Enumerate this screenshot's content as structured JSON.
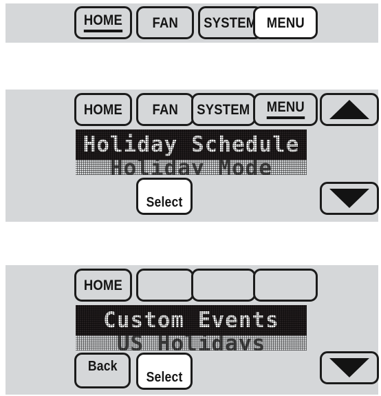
{
  "colors": {
    "panel_bg": "#d5d7d9",
    "key_bg": "#d5d7d9",
    "key_active_bg": "#ffffff",
    "key_border": "#1b1b1b",
    "lcd_bar_bg": "#241f20",
    "lcd_text_on": "#ffffff",
    "lcd_text_dim": "#4c4c4c",
    "page_bg": "#ffffff"
  },
  "panels": [
    {
      "id": "panel-1",
      "menu_keys": [
        {
          "label": "HOME",
          "state": "underlined"
        },
        {
          "label": "FAN",
          "state": "normal"
        },
        {
          "label": "SYSTEM",
          "state": "normal"
        },
        {
          "label": "MENU",
          "state": "highlighted"
        }
      ]
    },
    {
      "id": "panel-2",
      "menu_keys": [
        {
          "label": "HOME",
          "state": "normal"
        },
        {
          "label": "FAN",
          "state": "normal"
        },
        {
          "label": "SYSTEM",
          "state": "normal"
        },
        {
          "label": "MENU",
          "state": "underlined"
        }
      ],
      "lcd": {
        "line1": "Holiday Schedule",
        "line2": "Holiday Mode"
      },
      "action_keys": [
        {
          "label": "Select",
          "state": "highlighted"
        }
      ],
      "scroll_keys": [
        {
          "icon": "arrow-up-icon"
        },
        {
          "icon": "arrow-down-icon"
        }
      ]
    },
    {
      "id": "panel-3",
      "menu_keys": [
        {
          "label": "HOME",
          "state": "normal"
        },
        {
          "label": "",
          "state": "normal"
        },
        {
          "label": "",
          "state": "normal"
        },
        {
          "label": "",
          "state": "normal"
        }
      ],
      "lcd": {
        "line1": "Custom Events",
        "line2": "US Holidays"
      },
      "action_keys": [
        {
          "label": "Back",
          "state": "normal"
        },
        {
          "label": "Select",
          "state": "highlighted"
        }
      ],
      "scroll_keys": [
        {
          "icon": "arrow-down-icon"
        }
      ]
    }
  ]
}
